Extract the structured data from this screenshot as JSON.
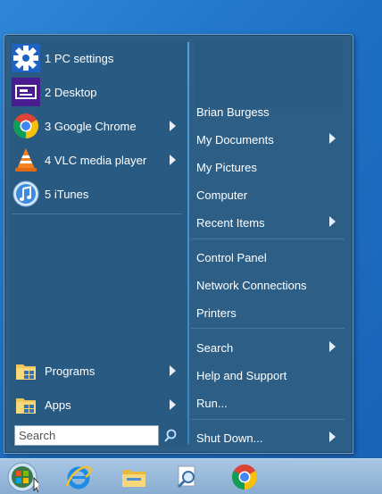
{
  "start_menu": {
    "pinned": [
      {
        "label": "1 PC settings",
        "icon": "gear-icon"
      },
      {
        "label": "2 Desktop",
        "icon": "desktop-icon"
      },
      {
        "label": "3 Google Chrome",
        "icon": "chrome-icon",
        "submenu": true
      },
      {
        "label": "4 VLC media player",
        "icon": "vlc-icon",
        "submenu": true
      },
      {
        "label": "5 iTunes",
        "icon": "itunes-icon"
      }
    ],
    "bottom_items": [
      {
        "label": "Programs",
        "icon": "programs-folder-icon",
        "submenu": true
      },
      {
        "label": "Apps",
        "icon": "apps-folder-icon",
        "submenu": true
      }
    ],
    "search": {
      "placeholder": "Search"
    },
    "right_links": {
      "user": "Brian Burgess",
      "documents": "My Documents",
      "pictures": "My Pictures",
      "computer": "Computer",
      "recent": "Recent Items",
      "control_panel": "Control Panel",
      "network": "Network Connections",
      "printers": "Printers",
      "search": "Search",
      "help": "Help and Support",
      "run": "Run...",
      "shutdown": "Shut Down..."
    }
  },
  "taskbar": {
    "items": [
      "start-orb-icon",
      "internet-explorer-icon",
      "file-explorer-icon",
      "search-magnifier-icon",
      "chrome-icon"
    ]
  },
  "colors": {
    "desktop": "#1d6fc4",
    "menu_bg": "#2d5f86",
    "accent_separator": "#4aa3df",
    "taskbar": "#a9c7e4"
  }
}
